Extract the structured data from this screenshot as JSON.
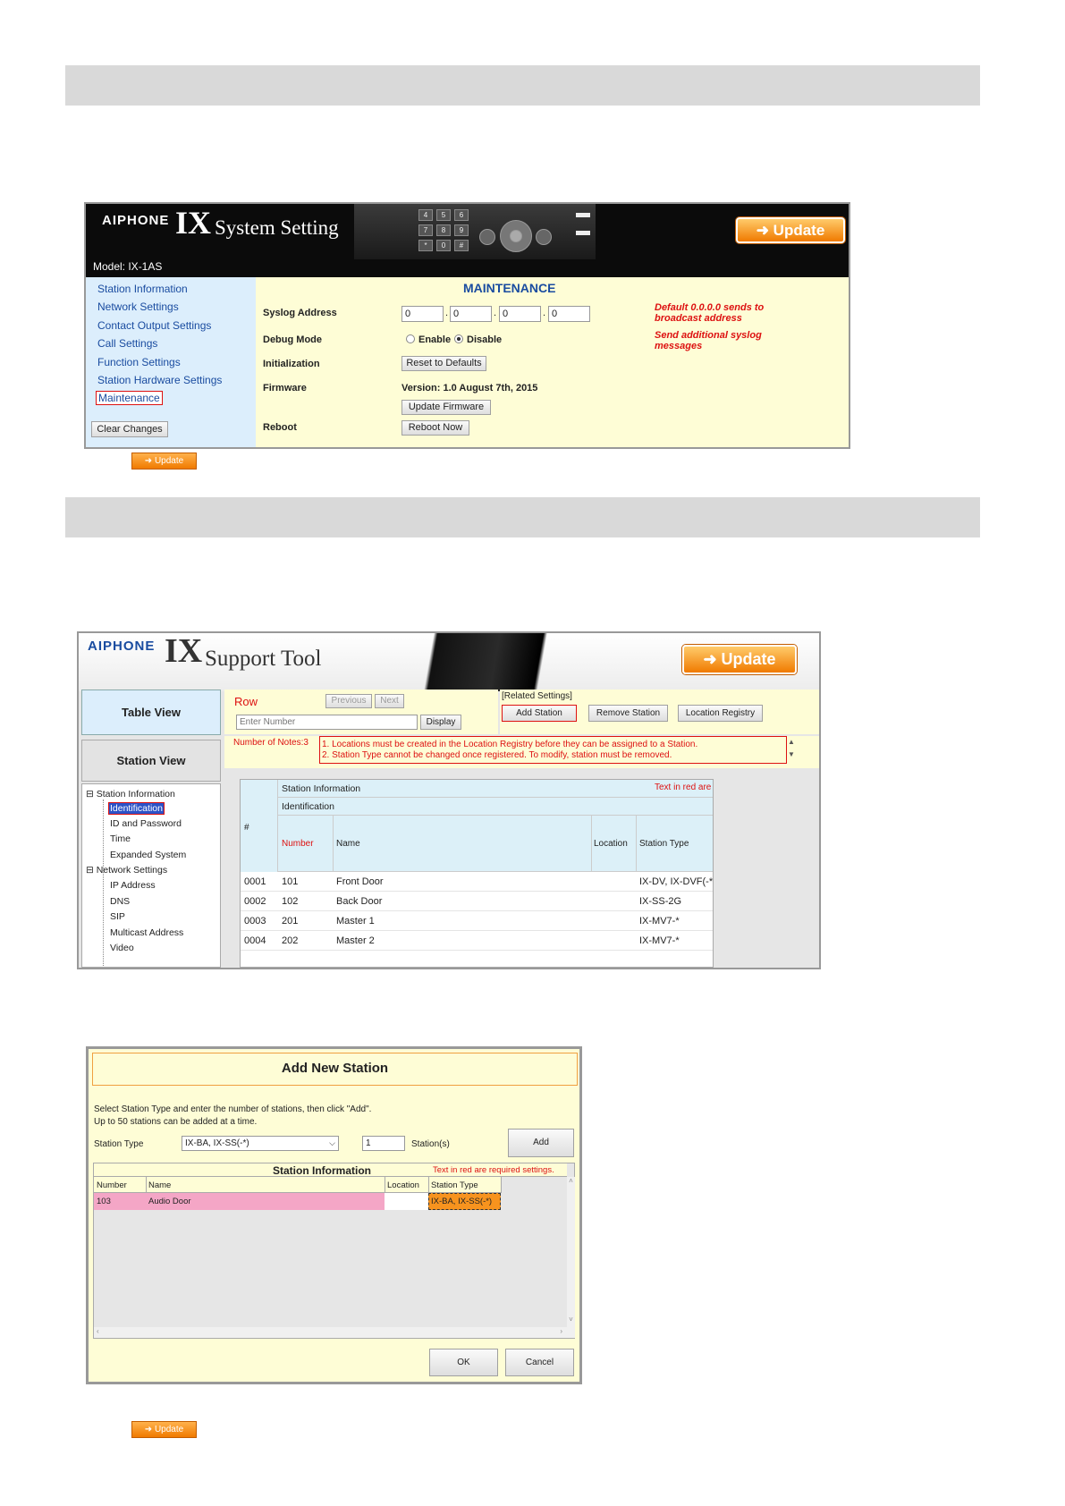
{
  "maintenance": {
    "logo": "AIPHONE",
    "app_title_big": "IX",
    "app_title_small": "System Setting",
    "model_label": "Model: IX-1AS",
    "update_label": "Update",
    "nav": [
      "Station Information",
      "Network Settings",
      "Contact Output Settings",
      "Call Settings",
      "Function Settings",
      "Station Hardware Settings",
      "Maintenance"
    ],
    "clear_changes": "Clear Changes",
    "section_title": "MAINTENANCE",
    "syslog_label": "Syslog Address",
    "syslog_values": [
      "0",
      "0",
      "0",
      "0"
    ],
    "debug_label": "Debug Mode",
    "debug_enable": "Enable",
    "debug_disable": "Disable",
    "init_label": "Initialization",
    "reset_button": "Reset to Defaults",
    "firmware_label": "Firmware",
    "firmware_version": "Version: 1.0 August 7th, 2015",
    "update_firmware_button": "Update Firmware",
    "reboot_label": "Reboot",
    "reboot_button": "Reboot Now",
    "note1": "Default 0.0.0.0 sends to broadcast address",
    "note2": "Send additional syslog messages",
    "keypad_keys": [
      "4",
      "5",
      "6",
      "7",
      "8",
      "9",
      "*",
      "0",
      "#"
    ]
  },
  "update_icon_label": "Update",
  "support_tool": {
    "logo": "AIPHONE",
    "app_title_big": "IX",
    "app_title_small": "Support Tool",
    "update_label": "Update",
    "table_view": "Table View",
    "station_view": "Station View",
    "row_label": "Row",
    "previous": "Previous",
    "next": "Next",
    "enter_number_placeholder": "Enter Number",
    "display_button": "Display",
    "related_settings": "[Related Settings]",
    "add_station": "Add Station",
    "remove_station": "Remove Station",
    "location_registry": "Location Registry",
    "notes_label": "Number of Notes:3",
    "notes": [
      "1. Locations must be created in the Location Registry before they can be assigned to a Station.",
      "2. Station Type cannot be changed once registered. To modify, station must be removed."
    ],
    "tree": {
      "station_info": "Station Information",
      "station_info_children": [
        "Identification",
        "ID and Password",
        "Time",
        "Expanded System"
      ],
      "network_settings": "Network Settings",
      "network_children": [
        "IP Address",
        "DNS",
        "SIP",
        "Multicast Address",
        "Video"
      ]
    },
    "table": {
      "group_header": "Station Information",
      "required_note": "Text in red are required settings.",
      "sub_header": "Identification",
      "hash": "#",
      "columns": [
        "Number",
        "Name",
        "Location",
        "Station Type"
      ],
      "rows": [
        [
          "0001",
          "101",
          "Front Door",
          "",
          "IX-DV, IX-DVF(-*)"
        ],
        [
          "0002",
          "102",
          "Back Door",
          "",
          "IX-SS-2G"
        ],
        [
          "0003",
          "201",
          "Master 1",
          "",
          "IX-MV7-*"
        ],
        [
          "0004",
          "202",
          "Master 2",
          "",
          "IX-MV7-*"
        ]
      ]
    }
  },
  "add_station_dialog": {
    "title": "Add New Station",
    "instruction1": "Select Station Type and enter the number of stations, then click \"Add\".",
    "instruction2": "Up to 50 stations can be added at a time.",
    "station_type_label": "Station Type",
    "station_type_value": "IX-BA, IX-SS(-*)",
    "count_value": "1",
    "stations_label": "Station(s)",
    "add_button": "Add",
    "info_header": "Station Information",
    "required_note": "Text in red are required settings.",
    "columns": [
      "Number",
      "Name",
      "Location",
      "Station Type"
    ],
    "row": [
      "103",
      "Audio Door",
      "",
      "IX-BA, IX-SS(-*)"
    ],
    "ok_button": "OK",
    "cancel_button": "Cancel"
  },
  "colors": {
    "orange": "#f07a00",
    "header_dark": "#0b0b0b",
    "nav_blue": "#dceefc",
    "panel_yellow": "#fefdd6",
    "required_red": "#d11",
    "row_pink": "#f4a6c6"
  }
}
